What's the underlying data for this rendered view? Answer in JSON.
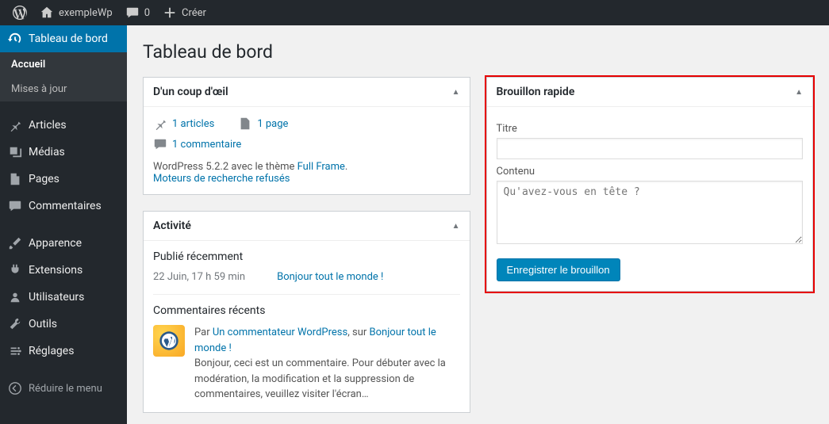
{
  "toolbar": {
    "site_name": "exempleWp",
    "comments_count": "0",
    "create_label": "Créer"
  },
  "sidebar": {
    "dashboard": "Tableau de bord",
    "home": "Accueil",
    "updates": "Mises à jour",
    "posts": "Articles",
    "media": "Médias",
    "pages": "Pages",
    "comments": "Commentaires",
    "appearance": "Apparence",
    "plugins": "Extensions",
    "users": "Utilisateurs",
    "tools": "Outils",
    "settings": "Réglages",
    "collapse": "Réduire le menu"
  },
  "page_title": "Tableau de bord",
  "glance": {
    "title": "D'un coup d'œil",
    "posts": "1 articles",
    "pages": "1 page",
    "comments": "1 commentaire",
    "version_prefix": "WordPress 5.2.2 avec le thème ",
    "theme": "Full Frame",
    "search": "Moteurs de recherche refusés"
  },
  "activity": {
    "title": "Activité",
    "recent_title": "Publié récemment",
    "recent_date": "22 Juin, 17 h 59 min",
    "recent_post": "Bonjour tout le monde !",
    "comments_title": "Commentaires récents",
    "comment_by": "Par ",
    "comment_author": "Un commentateur WordPress",
    "comment_on": ", sur ",
    "comment_post": "Bonjour tout le monde !",
    "comment_body": "Bonjour, ceci est un commentaire. Pour débuter avec la modération, la modification et la suppression de commentaires, veuillez visiter l'écran…"
  },
  "draft": {
    "title": "Brouillon rapide",
    "title_label": "Titre",
    "content_label": "Contenu",
    "content_placeholder": "Qu'avez-vous en tête ?",
    "save_label": "Enregistrer le brouillon"
  }
}
